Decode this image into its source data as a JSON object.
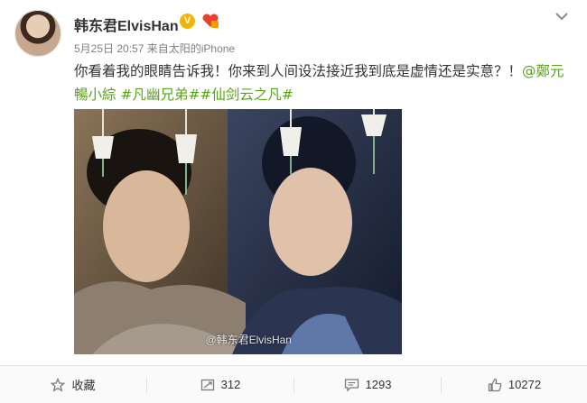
{
  "post": {
    "username": "韩东君ElvisHan",
    "verified_badge": "V",
    "timestamp": "5月25日 20:57",
    "source": "来自太阳的iPhone",
    "text_main": "你看着我的眼睛告诉我！你来到人间设法接近我到底是虚情还是实意？！",
    "mention": "@鄭元暢小綜",
    "hashtags": "#凡幽兄弟##仙剑云之凡#",
    "image_watermark": "@韩东君ElvisHan"
  },
  "actions": {
    "favorite_label": "收藏",
    "repost_count": "312",
    "comment_count": "1293",
    "like_count": "10272"
  },
  "icons": {
    "menu": "chevron-down-icon",
    "favorite": "star-icon",
    "repost": "repost-icon",
    "comment": "comment-icon",
    "like": "thumbs-up-icon"
  },
  "colors": {
    "link_green": "#5aa31a",
    "verified_gold": "#f4b400",
    "meta_gray": "#808080"
  }
}
